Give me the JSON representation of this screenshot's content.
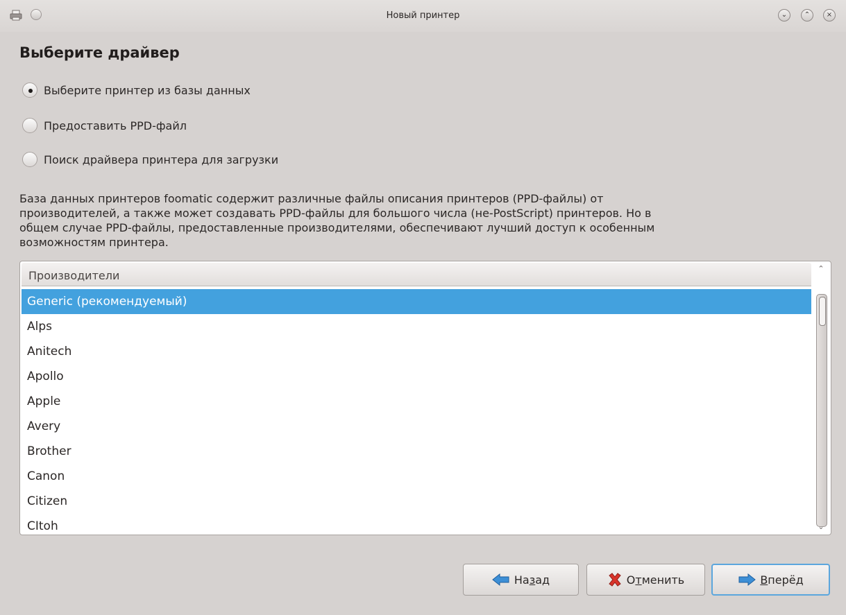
{
  "window": {
    "title": "Новый принтер",
    "icons": [
      "printer-icon",
      "circle-icon"
    ],
    "controls": [
      "minimize-icon",
      "maximize-icon",
      "close-icon"
    ]
  },
  "page": {
    "heading": "Выберите драйвер"
  },
  "options": [
    {
      "label": "Выберите принтер из базы данных",
      "checked": true
    },
    {
      "label": "Предоставить PPD-файл",
      "checked": false
    },
    {
      "label": "Поиск драйвера принтера для загрузки",
      "checked": false
    }
  ],
  "description": {
    "line1": "База данных принтеров foomatic содержит различные файлы описания принтеров (PPD-файлы) от",
    "line2": "производителей, а также может создавать PPD-файлы для большого числа (не-PostScript) принтеров. Но в",
    "line3": "общем случае PPD-файлы, предоставленные производителями, обеспечивают лучший доступ к особенным",
    "line4": "возможностям принтера."
  },
  "list": {
    "header": "Производители",
    "selected_index": 0,
    "items": [
      "Generic (рекомендуемый)",
      "Alps",
      "Anitech",
      "Apollo",
      "Apple",
      "Avery",
      "Brother",
      "Canon",
      "Citizen",
      "CItoh"
    ]
  },
  "buttons": {
    "back": {
      "pre": "На",
      "accel": "з",
      "post": "ад"
    },
    "cancel": {
      "pre": "О",
      "accel": "т",
      "post": "менить"
    },
    "next": {
      "pre": "",
      "accel": "В",
      "post": "перёд"
    }
  },
  "colors": {
    "selection": "#43a1de",
    "background": "#d6d2d0",
    "default_button_border": "#5ba6dd"
  }
}
